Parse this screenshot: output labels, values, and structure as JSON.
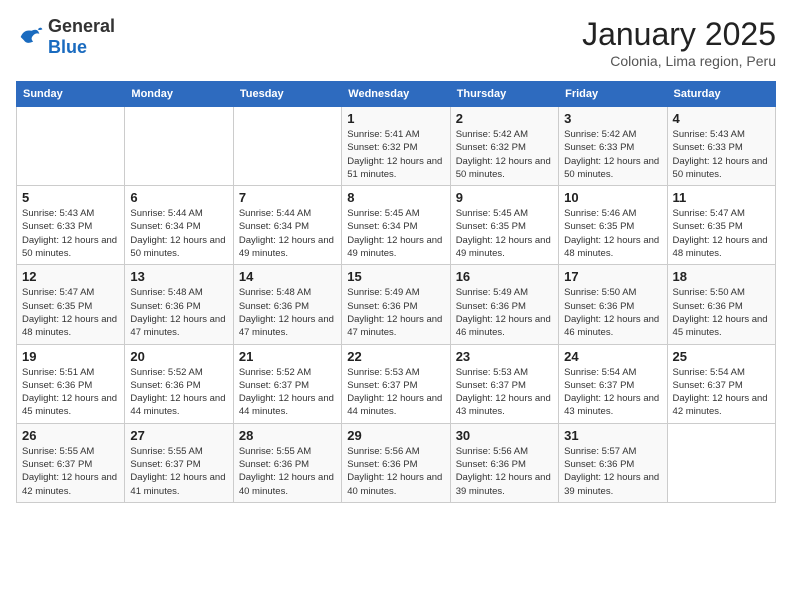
{
  "header": {
    "logo_general": "General",
    "logo_blue": "Blue",
    "title": "January 2025",
    "location": "Colonia, Lima region, Peru"
  },
  "weekdays": [
    "Sunday",
    "Monday",
    "Tuesday",
    "Wednesday",
    "Thursday",
    "Friday",
    "Saturday"
  ],
  "weeks": [
    [
      {
        "day": "",
        "sunrise": "",
        "sunset": "",
        "daylight": ""
      },
      {
        "day": "",
        "sunrise": "",
        "sunset": "",
        "daylight": ""
      },
      {
        "day": "",
        "sunrise": "",
        "sunset": "",
        "daylight": ""
      },
      {
        "day": "1",
        "sunrise": "Sunrise: 5:41 AM",
        "sunset": "Sunset: 6:32 PM",
        "daylight": "Daylight: 12 hours and 51 minutes."
      },
      {
        "day": "2",
        "sunrise": "Sunrise: 5:42 AM",
        "sunset": "Sunset: 6:32 PM",
        "daylight": "Daylight: 12 hours and 50 minutes."
      },
      {
        "day": "3",
        "sunrise": "Sunrise: 5:42 AM",
        "sunset": "Sunset: 6:33 PM",
        "daylight": "Daylight: 12 hours and 50 minutes."
      },
      {
        "day": "4",
        "sunrise": "Sunrise: 5:43 AM",
        "sunset": "Sunset: 6:33 PM",
        "daylight": "Daylight: 12 hours and 50 minutes."
      }
    ],
    [
      {
        "day": "5",
        "sunrise": "Sunrise: 5:43 AM",
        "sunset": "Sunset: 6:33 PM",
        "daylight": "Daylight: 12 hours and 50 minutes."
      },
      {
        "day": "6",
        "sunrise": "Sunrise: 5:44 AM",
        "sunset": "Sunset: 6:34 PM",
        "daylight": "Daylight: 12 hours and 50 minutes."
      },
      {
        "day": "7",
        "sunrise": "Sunrise: 5:44 AM",
        "sunset": "Sunset: 6:34 PM",
        "daylight": "Daylight: 12 hours and 49 minutes."
      },
      {
        "day": "8",
        "sunrise": "Sunrise: 5:45 AM",
        "sunset": "Sunset: 6:34 PM",
        "daylight": "Daylight: 12 hours and 49 minutes."
      },
      {
        "day": "9",
        "sunrise": "Sunrise: 5:45 AM",
        "sunset": "Sunset: 6:35 PM",
        "daylight": "Daylight: 12 hours and 49 minutes."
      },
      {
        "day": "10",
        "sunrise": "Sunrise: 5:46 AM",
        "sunset": "Sunset: 6:35 PM",
        "daylight": "Daylight: 12 hours and 48 minutes."
      },
      {
        "day": "11",
        "sunrise": "Sunrise: 5:47 AM",
        "sunset": "Sunset: 6:35 PM",
        "daylight": "Daylight: 12 hours and 48 minutes."
      }
    ],
    [
      {
        "day": "12",
        "sunrise": "Sunrise: 5:47 AM",
        "sunset": "Sunset: 6:35 PM",
        "daylight": "Daylight: 12 hours and 48 minutes."
      },
      {
        "day": "13",
        "sunrise": "Sunrise: 5:48 AM",
        "sunset": "Sunset: 6:36 PM",
        "daylight": "Daylight: 12 hours and 47 minutes."
      },
      {
        "day": "14",
        "sunrise": "Sunrise: 5:48 AM",
        "sunset": "Sunset: 6:36 PM",
        "daylight": "Daylight: 12 hours and 47 minutes."
      },
      {
        "day": "15",
        "sunrise": "Sunrise: 5:49 AM",
        "sunset": "Sunset: 6:36 PM",
        "daylight": "Daylight: 12 hours and 47 minutes."
      },
      {
        "day": "16",
        "sunrise": "Sunrise: 5:49 AM",
        "sunset": "Sunset: 6:36 PM",
        "daylight": "Daylight: 12 hours and 46 minutes."
      },
      {
        "day": "17",
        "sunrise": "Sunrise: 5:50 AM",
        "sunset": "Sunset: 6:36 PM",
        "daylight": "Daylight: 12 hours and 46 minutes."
      },
      {
        "day": "18",
        "sunrise": "Sunrise: 5:50 AM",
        "sunset": "Sunset: 6:36 PM",
        "daylight": "Daylight: 12 hours and 45 minutes."
      }
    ],
    [
      {
        "day": "19",
        "sunrise": "Sunrise: 5:51 AM",
        "sunset": "Sunset: 6:36 PM",
        "daylight": "Daylight: 12 hours and 45 minutes."
      },
      {
        "day": "20",
        "sunrise": "Sunrise: 5:52 AM",
        "sunset": "Sunset: 6:36 PM",
        "daylight": "Daylight: 12 hours and 44 minutes."
      },
      {
        "day": "21",
        "sunrise": "Sunrise: 5:52 AM",
        "sunset": "Sunset: 6:37 PM",
        "daylight": "Daylight: 12 hours and 44 minutes."
      },
      {
        "day": "22",
        "sunrise": "Sunrise: 5:53 AM",
        "sunset": "Sunset: 6:37 PM",
        "daylight": "Daylight: 12 hours and 44 minutes."
      },
      {
        "day": "23",
        "sunrise": "Sunrise: 5:53 AM",
        "sunset": "Sunset: 6:37 PM",
        "daylight": "Daylight: 12 hours and 43 minutes."
      },
      {
        "day": "24",
        "sunrise": "Sunrise: 5:54 AM",
        "sunset": "Sunset: 6:37 PM",
        "daylight": "Daylight: 12 hours and 43 minutes."
      },
      {
        "day": "25",
        "sunrise": "Sunrise: 5:54 AM",
        "sunset": "Sunset: 6:37 PM",
        "daylight": "Daylight: 12 hours and 42 minutes."
      }
    ],
    [
      {
        "day": "26",
        "sunrise": "Sunrise: 5:55 AM",
        "sunset": "Sunset: 6:37 PM",
        "daylight": "Daylight: 12 hours and 42 minutes."
      },
      {
        "day": "27",
        "sunrise": "Sunrise: 5:55 AM",
        "sunset": "Sunset: 6:37 PM",
        "daylight": "Daylight: 12 hours and 41 minutes."
      },
      {
        "day": "28",
        "sunrise": "Sunrise: 5:55 AM",
        "sunset": "Sunset: 6:36 PM",
        "daylight": "Daylight: 12 hours and 40 minutes."
      },
      {
        "day": "29",
        "sunrise": "Sunrise: 5:56 AM",
        "sunset": "Sunset: 6:36 PM",
        "daylight": "Daylight: 12 hours and 40 minutes."
      },
      {
        "day": "30",
        "sunrise": "Sunrise: 5:56 AM",
        "sunset": "Sunset: 6:36 PM",
        "daylight": "Daylight: 12 hours and 39 minutes."
      },
      {
        "day": "31",
        "sunrise": "Sunrise: 5:57 AM",
        "sunset": "Sunset: 6:36 PM",
        "daylight": "Daylight: 12 hours and 39 minutes."
      },
      {
        "day": "",
        "sunrise": "",
        "sunset": "",
        "daylight": ""
      }
    ]
  ]
}
